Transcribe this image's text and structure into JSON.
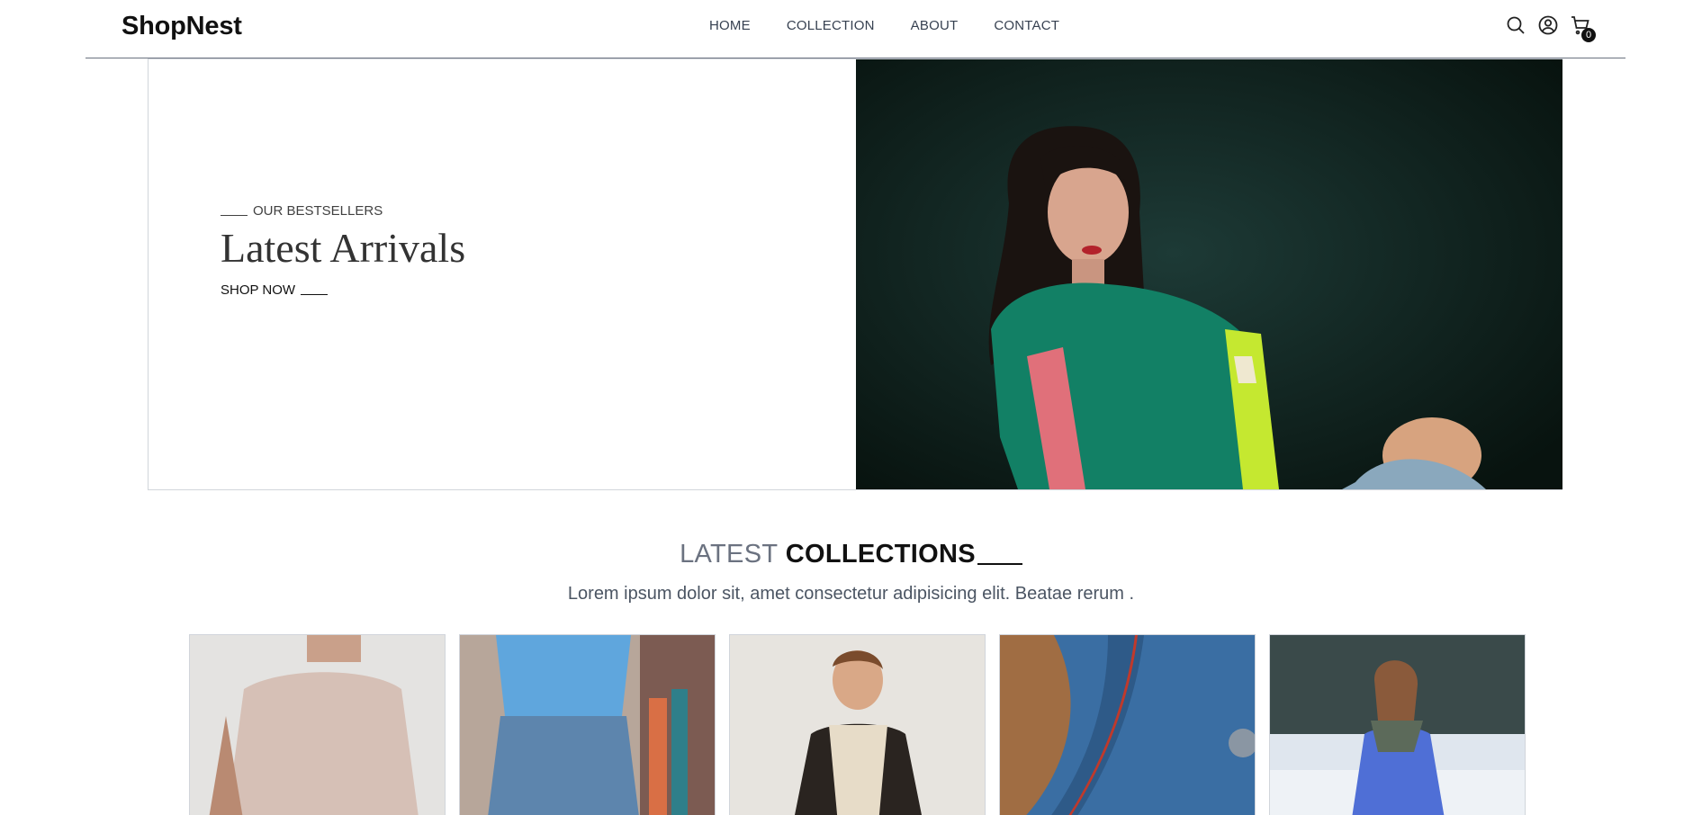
{
  "brand": {
    "name": "ShopNest"
  },
  "nav": {
    "links": [
      {
        "label": "HOME"
      },
      {
        "label": "COLLECTION"
      },
      {
        "label": "ABOUT"
      },
      {
        "label": "CONTACT"
      }
    ],
    "icons": [
      "search-icon",
      "user-icon",
      "cart-icon"
    ],
    "cart_count": "0"
  },
  "hero": {
    "eyebrow": "OUR BESTSELLERS",
    "title": "Latest Arrivals",
    "cta": "SHOP NOW"
  },
  "collections": {
    "title_light": "LATEST",
    "title_bold": "COLLECTIONS",
    "subtitle": "Lorem ipsum dolor sit, amet consectetur adipisicing elit. Beatae rerum ."
  },
  "colors": {
    "text_dark": "#111111",
    "text_muted": "#6b7280",
    "border": "#d1d5db"
  }
}
